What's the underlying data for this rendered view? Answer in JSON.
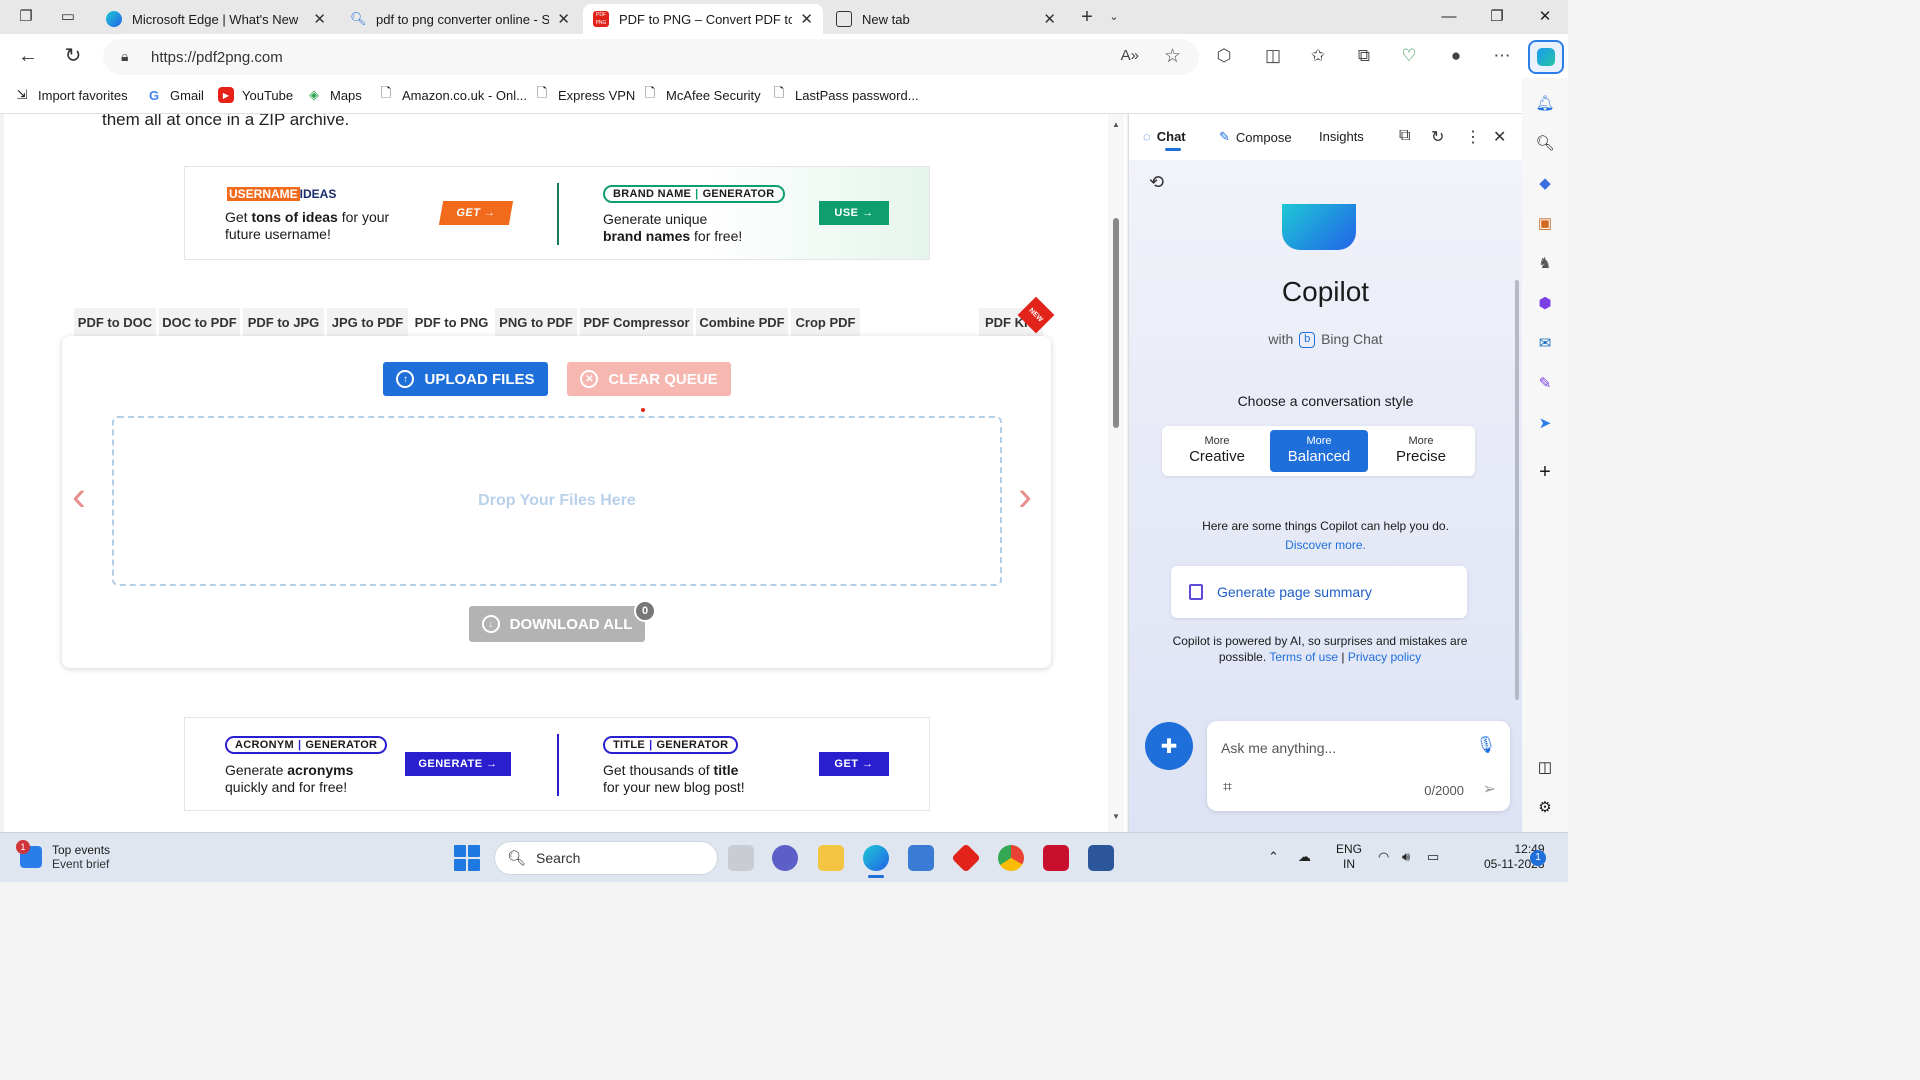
{
  "browser": {
    "tabs": [
      {
        "title": "Microsoft Edge | What's New",
        "active": false
      },
      {
        "title": "pdf to png converter online - Sea",
        "active": false
      },
      {
        "title": "PDF to PNG – Convert PDF to PN",
        "active": true
      },
      {
        "title": "New tab",
        "active": false
      }
    ],
    "url": "https://pdf2png.com",
    "bookmarks": [
      "Import favorites",
      "Gmail",
      "YouTube",
      "Maps",
      "Amazon.co.uk - Onl...",
      "Express VPN",
      "McAfee Security",
      "LastPass password..."
    ]
  },
  "page": {
    "intro_text": "them all at once in a ZIP archive.",
    "ad_top": {
      "left": {
        "brand_a": "USERNAME",
        "brand_b": "IDEAS",
        "line1_pre": "Get ",
        "line1_bold": "tons of ideas",
        "line1_post": " for your",
        "line2": "future username!",
        "button": "GET →"
      },
      "right": {
        "brand_a": "BRAND NAME",
        "brand_b": "GENERATOR",
        "line1": "Generate unique",
        "line2_bold": "brand names",
        "line2_post": " for free!",
        "button": "USE →"
      }
    },
    "tool_tabs": [
      "PDF to DOC",
      "DOC to PDF",
      "PDF to JPG",
      "JPG to PDF",
      "PDF to PNG",
      "PNG to PDF",
      "PDF Compressor",
      "Combine PDF",
      "Crop PDF"
    ],
    "active_tool_tab": "PDF to PNG",
    "pdf_kit": "PDF Kit",
    "pdf_kit_badge": "NEW",
    "upload_label": "UPLOAD FILES",
    "clear_label": "CLEAR QUEUE",
    "drop_label": "Drop Your Files Here",
    "download_label": "DOWNLOAD ALL",
    "download_count": "0",
    "ad_bottom": {
      "left": {
        "brand_a": "ACRONYM",
        "brand_b": "GENERATOR",
        "line1_pre": "Generate ",
        "line1_bold": "acronyms",
        "line2": "quickly and for free!",
        "button": "GENERATE →"
      },
      "right": {
        "brand_a": "TITLE",
        "brand_b": "GENERATOR",
        "line1_pre": "Get thousands of ",
        "line1_bold": "title",
        "line2": "for your new blog post!",
        "button": "GET →"
      }
    }
  },
  "copilot": {
    "tabs": [
      "Chat",
      "Compose",
      "Insights"
    ],
    "title": "Copilot",
    "with_pre": "with",
    "with_brand": "Bing Chat",
    "choose_style": "Choose a conversation style",
    "styles": [
      {
        "more": "More",
        "name": "Creative",
        "selected": false
      },
      {
        "more": "More",
        "name": "Balanced",
        "selected": true
      },
      {
        "more": "More",
        "name": "Precise",
        "selected": false
      }
    ],
    "help_text": "Here are some things Copilot can help you do.",
    "discover": "Discover more.",
    "generate_summary": "Generate page summary",
    "note_pre": "Copilot is powered by AI, so surprises and mistakes are possible.",
    "terms": "Terms of use",
    "sep": "|",
    "privacy": "Privacy policy",
    "ask_placeholder": "Ask me anything...",
    "char_count": "0/2000"
  },
  "taskbar": {
    "news_title": "Top events",
    "news_sub": "Event brief",
    "news_badge": "1",
    "search_label": "Search",
    "lang1": "ENG",
    "lang2": "IN",
    "time": "12:49",
    "date": "05-11-2023",
    "notif_count": "1"
  },
  "colors": {
    "accent": "#1e6fd9",
    "clear_button": "#f5b7b0",
    "download_button": "#b3b3b3",
    "chevron": "#e88f8a",
    "ad_orange": "#f26b1d",
    "ad_green": "#0f9f6e",
    "ad_indigo": "#2a1fcf"
  }
}
